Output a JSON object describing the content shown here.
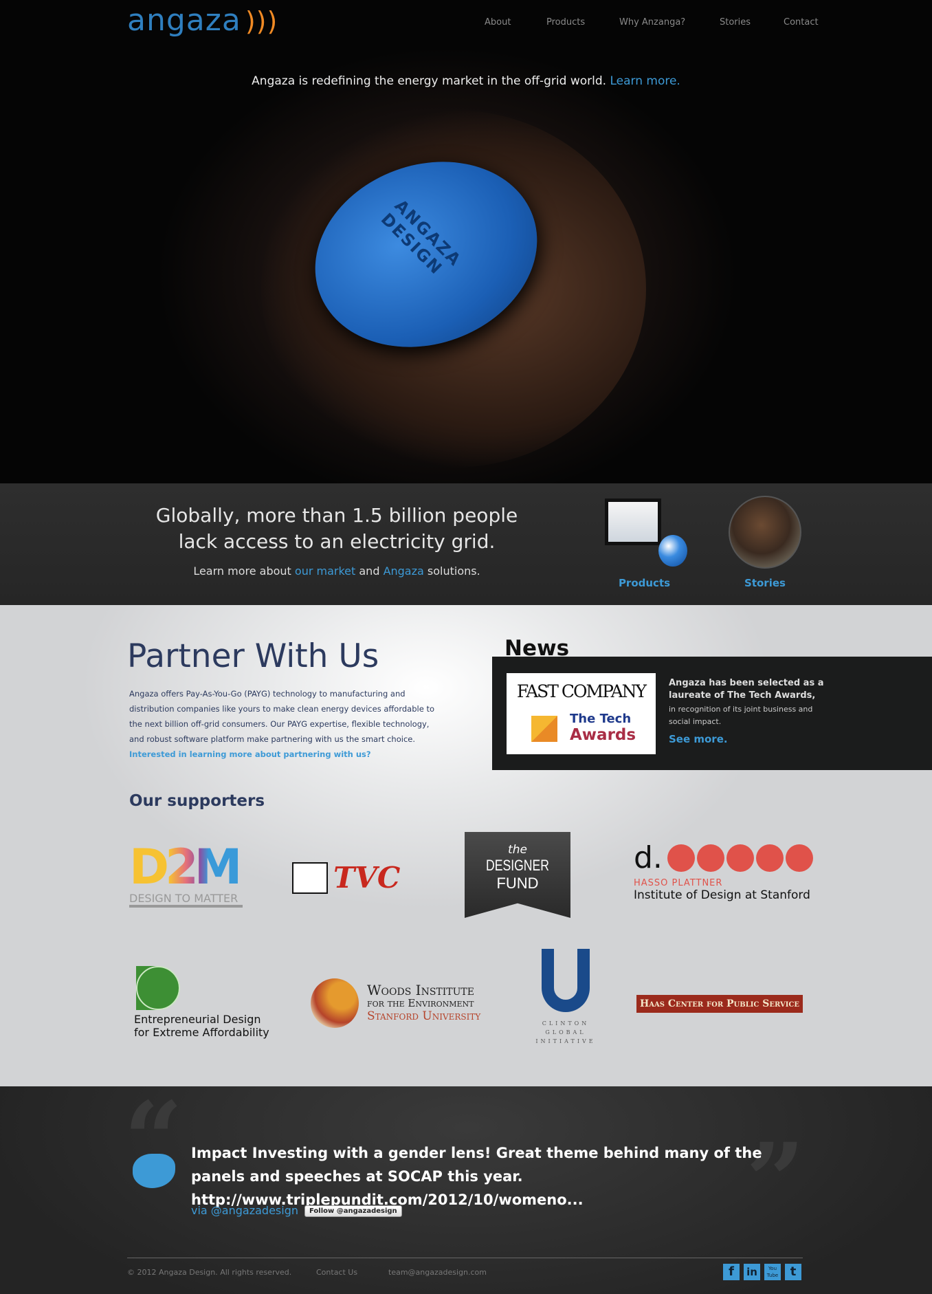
{
  "brand": {
    "name": "angaza",
    "color": "#2f7fbf",
    "accent": "#f08a24"
  },
  "nav": [
    "About",
    "Products",
    "Why Anzanga?",
    "Stories",
    "Contact"
  ],
  "hero": {
    "tagline": "Angaza is redefining the energy market in the off-grid world.",
    "link": "Learn more.",
    "device_text": "ANGAZA DESIGN"
  },
  "band": {
    "headline1": "Globally, more than 1.5 billion people",
    "headline2": "lack access to an electricity grid.",
    "sub_pre": "Learn more about ",
    "sub_link1": "our market",
    "sub_mid": " and ",
    "sub_link2": "Angaza",
    "sub_post": " solutions.",
    "products": "Products",
    "stories": "Stories"
  },
  "partner": {
    "title": "Partner With Us",
    "body": "Angaza offers Pay-As-You-Go (PAYG) technology to manufacturing and distribution companies like yours to make clean energy devices affordable to the next billion off-grid consumers. Our PAYG expertise, flexible technology, and robust software platform make partnering with us the smart choice. ",
    "link": "Interested in learning more about partnering with us?"
  },
  "news": {
    "title": "News",
    "logo1": "FAST COMPANY",
    "logo2a": "The Tech",
    "logo2b": "Awards",
    "headline": "Angaza has been selected as a laureate of The Tech Awards,",
    "body": "in recognition of its joint business and social impact.",
    "link": "See more."
  },
  "supporters": {
    "title": "Our supporters",
    "d2m": "DESIGN TO MATTER",
    "d2m_mark": "D2M",
    "tvc": "TVC",
    "designer_the": "the",
    "designer1": "DESIGNER",
    "designer2": "FUND",
    "dschool_d": "d.",
    "dschool1": "HASSO PLATTNER",
    "dschool2": "Institute of Design at Stanford",
    "edea1": "Entrepreneurial Design",
    "edea2": "for Extreme Affordability",
    "woods1": "Woods Institute",
    "woods2": "for the Environment",
    "woods3": "Stanford University",
    "cgi": [
      "CLINTON",
      "GLOBAL",
      "INITIATIVE"
    ],
    "haas": "Haas Center for Public Service"
  },
  "tweet": {
    "text": "Impact Investing with a gender lens! Great theme behind many of the panels and speeches at SOCAP this year. http://www.triplepundit.com/2012/10/womeno...",
    "via": "via @angazadesign",
    "follow": "Follow @angazadesign"
  },
  "footer": {
    "copyright": "© 2012 Angaza Design. All rights reserved.",
    "contact": "Contact Us",
    "email": "team@angazadesign.com",
    "social": [
      "f",
      "in",
      "You Tube",
      "t"
    ]
  }
}
